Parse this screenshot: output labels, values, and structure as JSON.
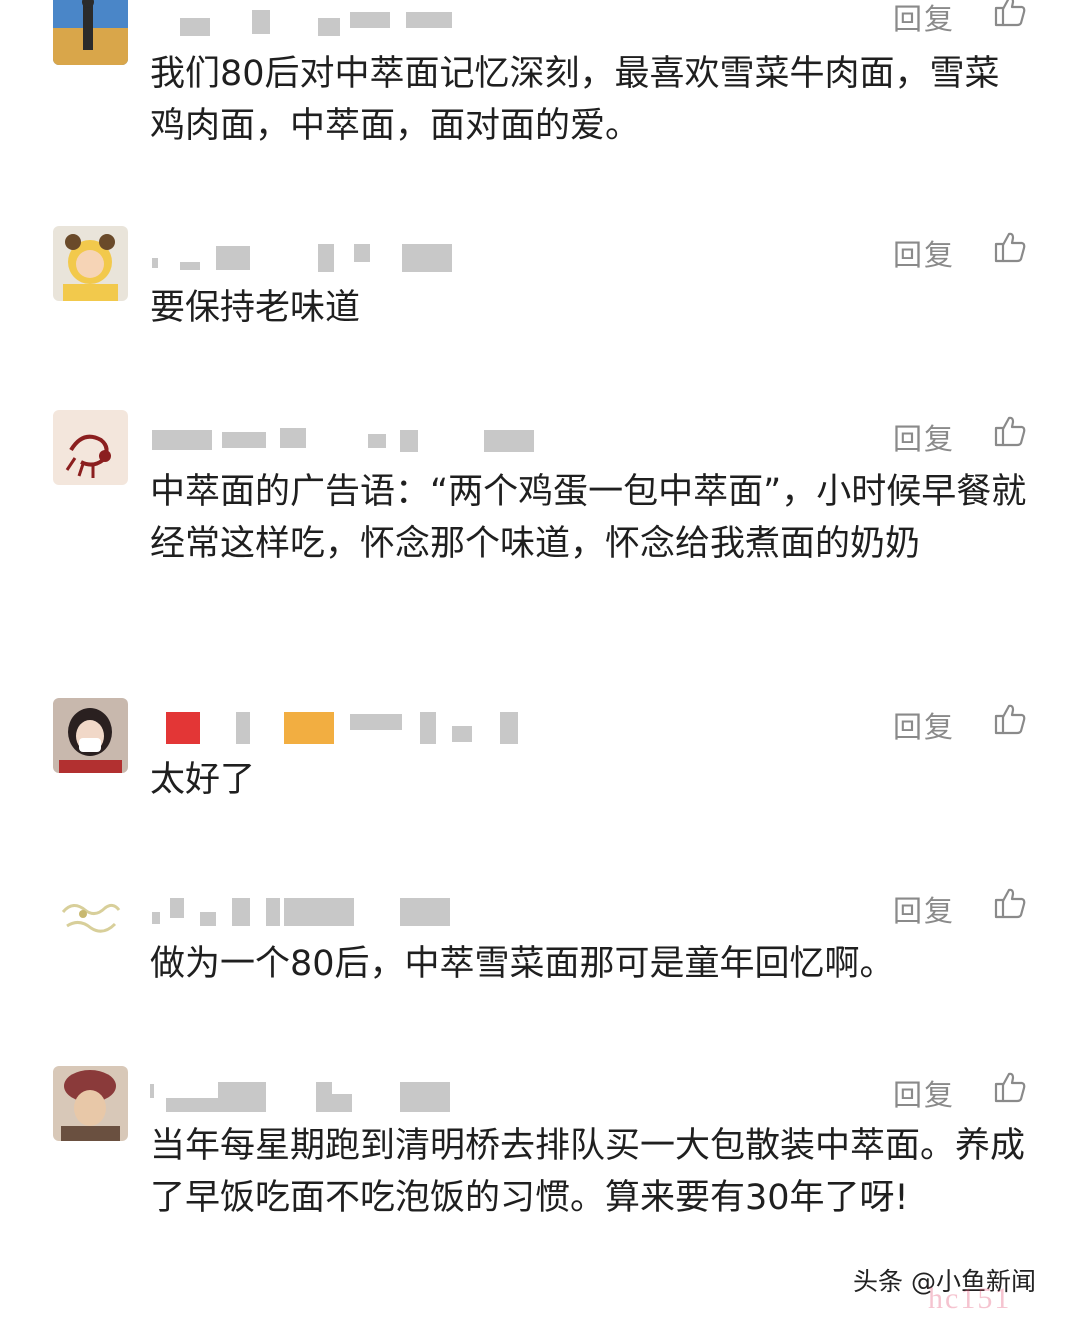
{
  "comments": [
    {
      "reply_label": "回复",
      "text": "我们80后对中萃面记忆深刻，最喜欢雪菜牛肉面，雪菜鸡肉面，中萃面，面对面的爱。",
      "avatar_color": "#d9a64a"
    },
    {
      "reply_label": "回复",
      "text": "要保持老味道",
      "avatar_color": "#f2c94c"
    },
    {
      "reply_label": "回复",
      "text": "中萃面的广告语：“两个鸡蛋一包中萃面”，小时候早餐就经常这样吃，怀念那个味道，怀念给我煮面的奶奶",
      "avatar_color": "#f3e6dc"
    },
    {
      "reply_label": "回复",
      "text": "太好了",
      "avatar_color": "#c8b8ad"
    },
    {
      "reply_label": "回复",
      "text": "做为一个80后，中萃雪菜面那可是童年回忆啊。",
      "avatar_color": "#f6f3dc"
    },
    {
      "reply_label": "回复",
      "text": "当年每星期跑到清明桥去排队买一大包散装中萃面。养成了早饭吃面不吃泡饭的习惯。算来要有30年了呀!",
      "avatar_color": "#8a6a58"
    }
  ],
  "watermark": {
    "text": "头条 @小鱼新闻",
    "overlay_text": "hc151"
  },
  "colors": {
    "reply": "#8a8a8a",
    "text": "#1f1f1f",
    "like_icon": "#8a8a8a"
  }
}
